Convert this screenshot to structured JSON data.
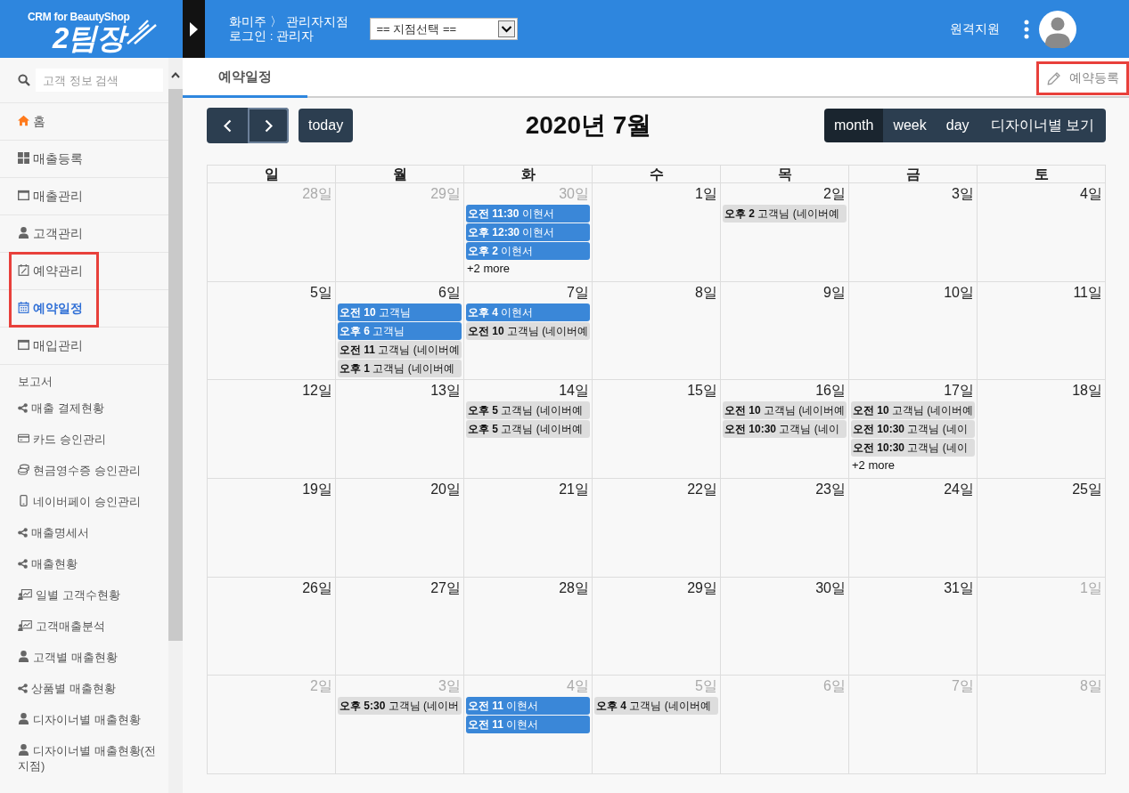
{
  "header": {
    "logo": {
      "tagline": "CRM for BeautyShop",
      "name": "2팀장"
    },
    "breadcrumb": "화미주 〉 관리자지점",
    "login": "로그인 : 관리자",
    "branch_select": {
      "value": "== 지점선택 =="
    },
    "remote_support": "원격지원"
  },
  "sidebar": {
    "search": {
      "placeholder": "고객 정보 검색"
    },
    "items": [
      {
        "label": "홈",
        "kind": "home",
        "selected": false,
        "highlighted": false
      },
      {
        "label": "매출등록",
        "kind": "grid",
        "selected": false,
        "highlighted": false
      },
      {
        "label": "매출관리",
        "kind": "window",
        "selected": false,
        "highlighted": false
      },
      {
        "label": "고객관리",
        "kind": "person",
        "selected": false,
        "highlighted": false
      },
      {
        "label": "예약관리",
        "kind": "calendar-edit",
        "selected": false,
        "highlighted": true
      },
      {
        "label": "예약일정",
        "kind": "calendar",
        "selected": true,
        "highlighted": true
      },
      {
        "label": "매입관리",
        "kind": "window",
        "selected": false,
        "highlighted": false
      }
    ],
    "section": "보고서",
    "report_items": [
      {
        "label": "매출 결제현황",
        "kind": "share",
        "selected": false
      },
      {
        "label": "카드 승인관리",
        "kind": "card",
        "selected": false
      },
      {
        "label": "현금영수증 승인관리",
        "kind": "cash",
        "selected": false
      },
      {
        "label": "네이버페이 승인관리",
        "kind": "phone",
        "selected": false
      },
      {
        "label": "매출명세서",
        "kind": "share",
        "selected": false
      },
      {
        "label": "매출현황",
        "kind": "share",
        "selected": false
      },
      {
        "label": "일별 고객수현황",
        "kind": "chart",
        "selected": false
      },
      {
        "label": "고객매출분석",
        "kind": "chart",
        "selected": false
      },
      {
        "label": "고객별 매출현황",
        "kind": "person",
        "selected": false
      },
      {
        "label": "상품별 매출현황",
        "kind": "share",
        "selected": false
      },
      {
        "label": "디자이너별 매출현황",
        "kind": "person",
        "selected": false
      },
      {
        "label": "디자이너별 매출현황(전지점)",
        "kind": "person",
        "selected": false
      }
    ]
  },
  "tabs": [
    {
      "label": "예약일정",
      "selected": true
    }
  ],
  "register_button": {
    "label": "예약등록",
    "highlighted": true
  },
  "toolbar": {
    "nav": [
      {
        "kind": "prev",
        "focused": false
      },
      {
        "kind": "next",
        "focused": true
      }
    ],
    "today": "today",
    "title": "2020년 7월",
    "views": [
      {
        "label": "month",
        "selected": true
      },
      {
        "label": "week",
        "selected": false
      },
      {
        "label": "day",
        "selected": false
      },
      {
        "label": "디자이너별 보기",
        "selected": false
      }
    ]
  },
  "calendar": {
    "weekdays": [
      "일",
      "월",
      "화",
      "수",
      "목",
      "금",
      "토"
    ],
    "weeks": [
      [
        {
          "day": "28일",
          "other_month": true
        },
        {
          "day": "29일",
          "other_month": true
        },
        {
          "day": "30일",
          "other_month": true,
          "events": [
            {
              "time": "오전 11:30",
              "title": "이현서",
              "color": "#3a87d8"
            },
            {
              "time": "오후 12:30",
              "title": "이현서",
              "color": "#3a87d8"
            },
            {
              "time": "오후 2",
              "title": "이현서",
              "color": "#3a87d8"
            }
          ],
          "more": "+2 more"
        },
        {
          "day": "1일",
          "other_month": false
        },
        {
          "day": "2일",
          "other_month": false,
          "events": [
            {
              "time": "오후 2",
              "title": "고객님 (네이버예",
              "color": "#dddddd"
            }
          ]
        },
        {
          "day": "3일",
          "other_month": false
        },
        {
          "day": "4일",
          "other_month": false
        }
      ],
      [
        {
          "day": "5일",
          "other_month": false
        },
        {
          "day": "6일",
          "other_month": false,
          "events": [
            {
              "time": "오전 10",
              "title": "고객님",
              "color": "#3a87d8"
            },
            {
              "time": "오후 6",
              "title": "고객님",
              "color": "#3a87d8"
            },
            {
              "time": "오전 11",
              "title": "고객님 (네이버예",
              "color": "#dddddd"
            },
            {
              "time": "오후 1",
              "title": "고객님 (네이버예",
              "color": "#dddddd"
            }
          ]
        },
        {
          "day": "7일",
          "other_month": false,
          "events": [
            {
              "time": "오후 4",
              "title": "이현서",
              "color": "#3a87d8"
            },
            {
              "time": "오전 10",
              "title": "고객님 (네이버예",
              "color": "#dddddd"
            }
          ]
        },
        {
          "day": "8일",
          "other_month": false
        },
        {
          "day": "9일",
          "other_month": false
        },
        {
          "day": "10일",
          "other_month": false
        },
        {
          "day": "11일",
          "other_month": false
        }
      ],
      [
        {
          "day": "12일",
          "other_month": false
        },
        {
          "day": "13일",
          "other_month": false
        },
        {
          "day": "14일",
          "other_month": false,
          "events": [
            {
              "time": "오후 5",
              "title": "고객님 (네이버예",
              "color": "#dddddd"
            },
            {
              "time": "오후 5",
              "title": "고객님 (네이버예",
              "color": "#dddddd"
            }
          ]
        },
        {
          "day": "15일",
          "other_month": false
        },
        {
          "day": "16일",
          "other_month": false,
          "events": [
            {
              "time": "오전 10",
              "title": "고객님 (네이버예",
              "color": "#dddddd"
            },
            {
              "time": "오전 10:30",
              "title": "고객님 (네이",
              "color": "#dddddd"
            }
          ]
        },
        {
          "day": "17일",
          "other_month": false,
          "events": [
            {
              "time": "오전 10",
              "title": "고객님 (네이버예",
              "color": "#dddddd"
            },
            {
              "time": "오전 10:30",
              "title": "고객님 (네이",
              "color": "#dddddd"
            },
            {
              "time": "오전 10:30",
              "title": "고객님 (네이",
              "color": "#dddddd"
            }
          ],
          "more": "+2 more"
        },
        {
          "day": "18일",
          "other_month": false
        }
      ],
      [
        {
          "day": "19일",
          "other_month": false
        },
        {
          "day": "20일",
          "other_month": false
        },
        {
          "day": "21일",
          "other_month": false
        },
        {
          "day": "22일",
          "other_month": false
        },
        {
          "day": "23일",
          "other_month": false
        },
        {
          "day": "24일",
          "other_month": false
        },
        {
          "day": "25일",
          "other_month": false
        }
      ],
      [
        {
          "day": "26일",
          "other_month": false
        },
        {
          "day": "27일",
          "other_month": false
        },
        {
          "day": "28일",
          "other_month": false
        },
        {
          "day": "29일",
          "other_month": false
        },
        {
          "day": "30일",
          "other_month": false
        },
        {
          "day": "31일",
          "other_month": false
        },
        {
          "day": "1일",
          "other_month": true
        }
      ],
      [
        {
          "day": "2일",
          "other_month": true
        },
        {
          "day": "3일",
          "other_month": true,
          "events": [
            {
              "time": "오후 5:30",
              "title": "고객님 (네이버",
              "color": "#dddddd"
            }
          ]
        },
        {
          "day": "4일",
          "other_month": true,
          "events": [
            {
              "time": "오전 11",
              "title": "이현서",
              "color": "#3a87d8"
            },
            {
              "time": "오전 11",
              "title": "이현서",
              "color": "#3a87d8"
            }
          ]
        },
        {
          "day": "5일",
          "other_month": true,
          "events": [
            {
              "time": "오후 4",
              "title": "고객님 (네이버예",
              "color": "#dddddd"
            }
          ]
        },
        {
          "day": "6일",
          "other_month": true
        },
        {
          "day": "7일",
          "other_month": true
        },
        {
          "day": "8일",
          "other_month": true
        }
      ]
    ]
  }
}
